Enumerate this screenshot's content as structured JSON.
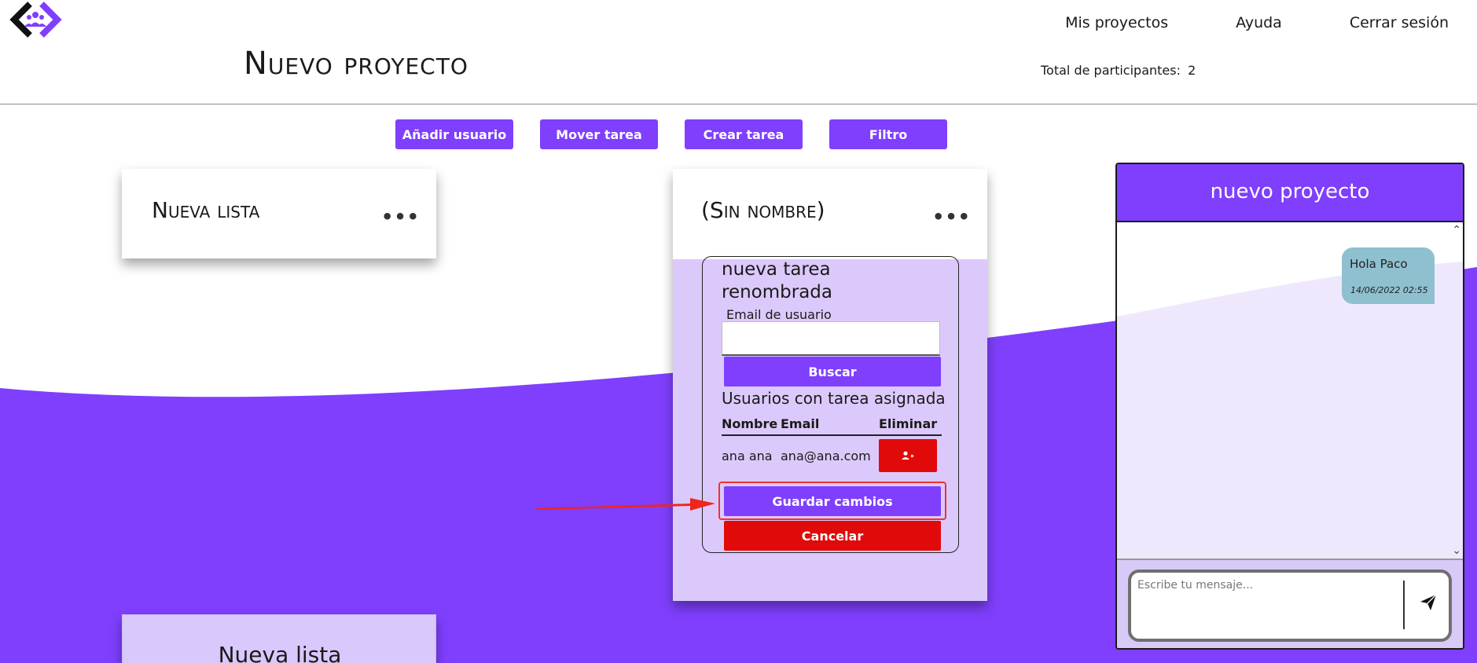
{
  "header": {
    "nav": [
      "Mis proyectos",
      "Ayuda",
      "Cerrar sesión"
    ],
    "title": "Nuevo proyecto",
    "participants_label": "Total de participantes:",
    "participants_count": "2"
  },
  "toolbar": {
    "add_user": "Añadir usuario",
    "move_task": "Mover tarea",
    "create_task": "Crear tarea",
    "filter": "Filtro"
  },
  "lists": [
    {
      "title": "Nueva lista",
      "menu": "•••"
    },
    {
      "title": "(Sin nombre)",
      "menu": "•••"
    },
    {
      "title": "Nueva lista"
    }
  ],
  "task": {
    "name": "nueva tarea renombrada",
    "email_label": "Email de usuario",
    "email_value": "",
    "search_button": "Buscar",
    "assigned_title": "Usuarios con tarea asignada",
    "columns": [
      "Nombre",
      "Email",
      "Eliminar"
    ],
    "rows": [
      {
        "name": "ana ana",
        "email": "ana@ana.com"
      }
    ],
    "save_button": "Guardar cambios",
    "cancel_button": "Cancelar"
  },
  "chat": {
    "title": "nuevo proyecto",
    "messages": [
      {
        "text": "Hola Paco",
        "time": "14/06/2022 02:55"
      }
    ],
    "input_placeholder": "Escribe tu mensaje..."
  },
  "colors": {
    "primary": "#7f3ffd",
    "danger": "#e10a0a",
    "lavender": "#dcc9fb",
    "message_bubble": "#8fc0cf",
    "highlight": "#f23030"
  },
  "icons": [
    "logo-icon",
    "more-dots-icon",
    "user-remove-icon",
    "send-icon",
    "chevron-up-icon",
    "chevron-down-icon"
  ]
}
